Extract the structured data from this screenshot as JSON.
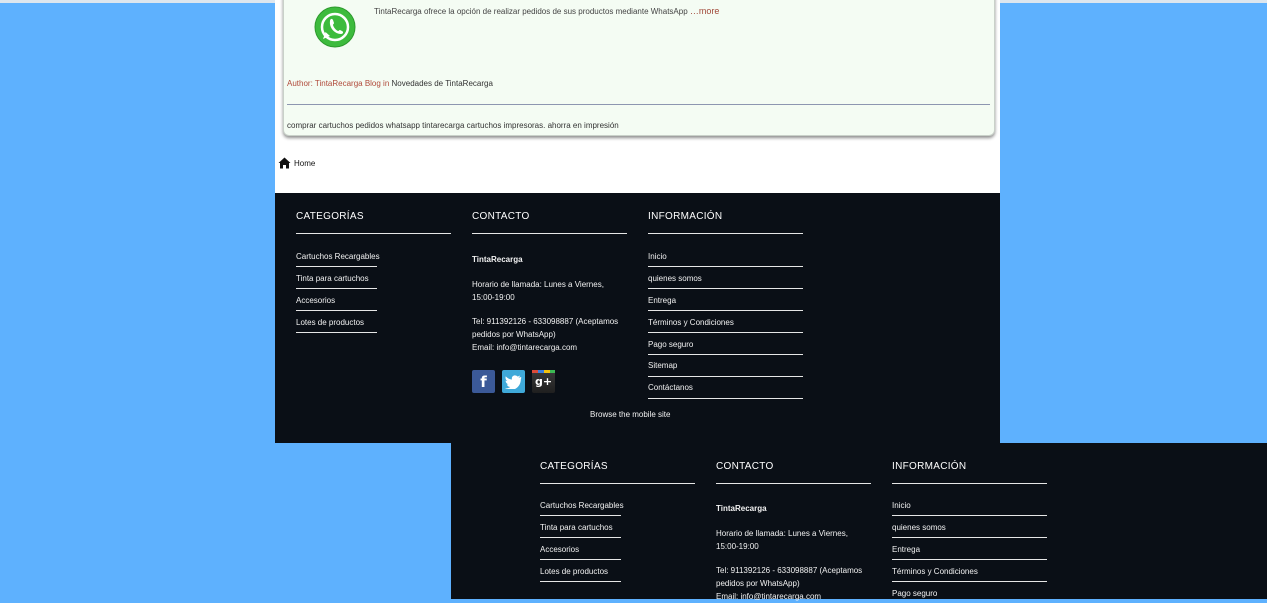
{
  "article": {
    "excerpt": "TintaRecarga ofrece la opción de realizar pedidos de sus productos mediante WhatsApp",
    "more": "…more",
    "author_label": "Author: TintaRecarga Blog in",
    "category": "Novedades de TintaRecarga",
    "tags": "comprar cartuchos pedidos whatsapp tintarecarga cartuchos impresoras. ahorra en impresión"
  },
  "breadcrumb": {
    "home": "Home"
  },
  "footer": {
    "categorias": {
      "title": "CATEGORÍAS",
      "items": [
        "Cartuchos Recargables",
        "Tinta para cartuchos",
        "Accesorios",
        "Lotes de productos"
      ]
    },
    "contacto": {
      "title": "CONTACTO",
      "company": "TintaRecarga",
      "hours": "Horario de llamada: Lunes a Viernes, 15:00-19:00",
      "phone": "Tel: 911392126 - 633098887 (Aceptamos pedidos por WhatsApp)",
      "email": "Email: info@tintarecarga.com"
    },
    "informacion": {
      "title": "INFORMACIÓN",
      "items": [
        "Inicio",
        "quienes somos",
        "Entrega",
        "Términos y Condiciones",
        "Pago seguro",
        "Sitemap",
        "Contáctanos"
      ]
    },
    "social": [
      {
        "name": "facebook-icon",
        "glyph": "f",
        "color": "#3b5998"
      },
      {
        "name": "twitter-icon",
        "glyph": "t",
        "color": "#3fa9d9"
      },
      {
        "name": "google-plus-icon",
        "glyph": "g+",
        "color": "#3a3a3a"
      }
    ],
    "mobile_link": "Browse the mobile site"
  },
  "colors": {
    "background": "#5eb1fe",
    "footer": "#0a0f16",
    "card": "#f4fcf3",
    "link_accent": "#b04a3a"
  }
}
